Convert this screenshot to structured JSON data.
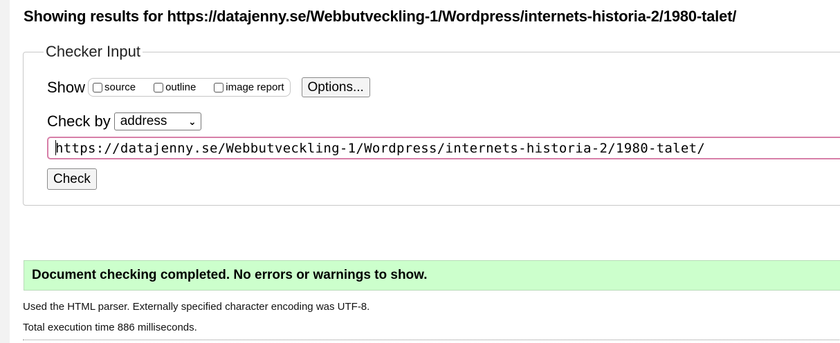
{
  "heading": "Showing results for https://datajenny.se/Webbutveckling-1/Wordpress/internets-historia-2/1980-talet/",
  "checker": {
    "legend": "Checker Input",
    "show_label": "Show",
    "show_options": [
      {
        "label": "source",
        "checked": false
      },
      {
        "label": "outline",
        "checked": false
      },
      {
        "label": "image report",
        "checked": false
      }
    ],
    "options_button": "Options...",
    "check_by_label": "Check by",
    "check_by_value": "address",
    "url_value": "https://datajenny.se/Webbutveckling-1/Wordpress/internets-historia-2/1980-talet/",
    "check_button": "Check"
  },
  "status": {
    "message": "Document checking completed. No errors or warnings to show.",
    "color": "#ccffcc"
  },
  "info": {
    "parser": "Used the HTML parser. Externally specified character encoding was UTF-8.",
    "execution": "Total execution time 886 milliseconds."
  }
}
